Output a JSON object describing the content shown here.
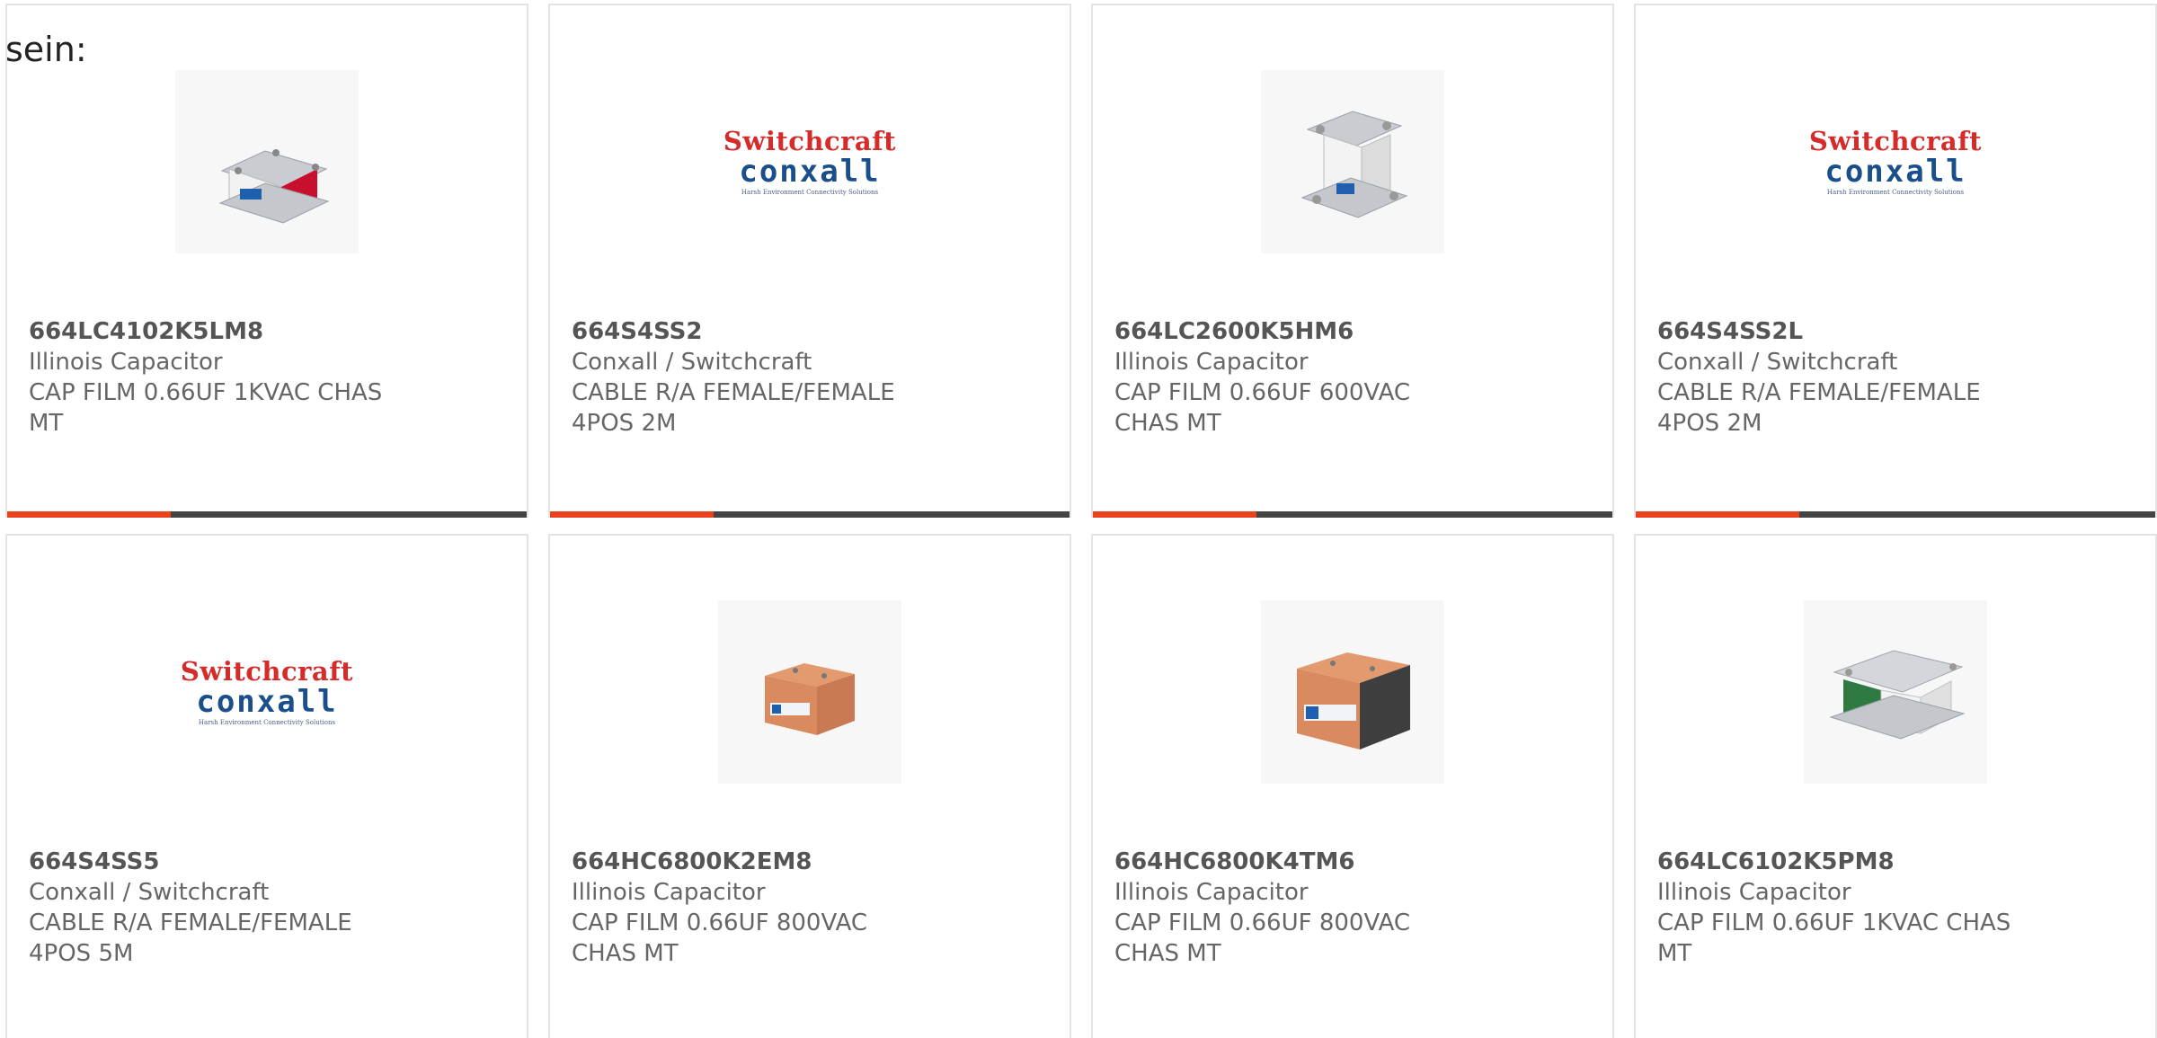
{
  "intro_text": "sein:",
  "colors": {
    "accent": "#e8431e",
    "bar": "#444444",
    "border": "#e4e4e4"
  },
  "products": [
    {
      "part_number": "664LC4102K5LM8",
      "manufacturer": "Illinois Capacitor",
      "description": "CAP FILM 0.66UF 1KVAC CHAS MT",
      "image": "capacitor-chassis-red-icon"
    },
    {
      "part_number": "664S4SS2",
      "manufacturer": "Conxall / Switchcraft",
      "description": "CABLE R/A FEMALE/FEMALE 4POS 2M",
      "image": "switchcraft-logo"
    },
    {
      "part_number": "664LC2600K5HM6",
      "manufacturer": "Illinois Capacitor",
      "description": "CAP FILM 0.66UF 600VAC CHAS MT",
      "image": "capacitor-chassis-white-icon"
    },
    {
      "part_number": "664S4SS2L",
      "manufacturer": "Conxall / Switchcraft",
      "description": "CABLE R/A FEMALE/FEMALE 4POS 2M",
      "image": "switchcraft-logo"
    },
    {
      "part_number": "664S4SS5",
      "manufacturer": "Conxall / Switchcraft",
      "description": "CABLE R/A FEMALE/FEMALE 4POS 5M",
      "image": "switchcraft-logo"
    },
    {
      "part_number": "664HC6800K2EM8",
      "manufacturer": "Illinois Capacitor",
      "description": "CAP FILM 0.66UF 800VAC CHAS MT",
      "image": "capacitor-block-small-icon"
    },
    {
      "part_number": "664HC6800K4TM6",
      "manufacturer": "Illinois Capacitor",
      "description": "CAP FILM 0.66UF 800VAC CHAS MT",
      "image": "capacitor-block-large-icon"
    },
    {
      "part_number": "664LC6102K5PM8",
      "manufacturer": "Illinois Capacitor",
      "description": "CAP FILM 0.66UF 1KVAC CHAS MT",
      "image": "capacitor-chassis-green-icon"
    }
  ],
  "logo": {
    "line1": "Switchcraft",
    "line2": "conxall",
    "line3": "Harsh Environment Connectivity Solutions"
  }
}
